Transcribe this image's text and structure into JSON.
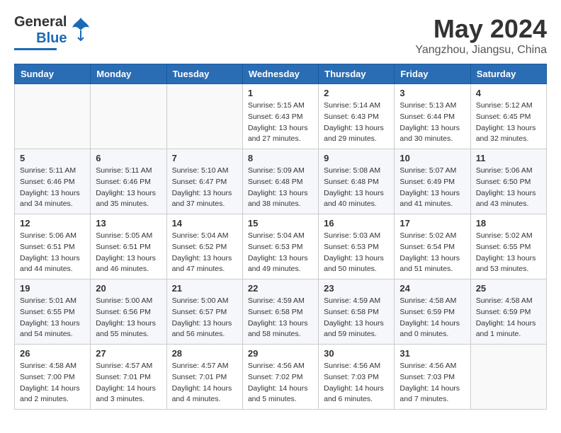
{
  "logo": {
    "line1": "General",
    "line2": "Blue"
  },
  "header": {
    "month_year": "May 2024",
    "location": "Yangzhou, Jiangsu, China"
  },
  "weekdays": [
    "Sunday",
    "Monday",
    "Tuesday",
    "Wednesday",
    "Thursday",
    "Friday",
    "Saturday"
  ],
  "weeks": [
    [
      {
        "day": "",
        "detail": ""
      },
      {
        "day": "",
        "detail": ""
      },
      {
        "day": "",
        "detail": ""
      },
      {
        "day": "1",
        "detail": "Sunrise: 5:15 AM\nSunset: 6:43 PM\nDaylight: 13 hours\nand 27 minutes."
      },
      {
        "day": "2",
        "detail": "Sunrise: 5:14 AM\nSunset: 6:43 PM\nDaylight: 13 hours\nand 29 minutes."
      },
      {
        "day": "3",
        "detail": "Sunrise: 5:13 AM\nSunset: 6:44 PM\nDaylight: 13 hours\nand 30 minutes."
      },
      {
        "day": "4",
        "detail": "Sunrise: 5:12 AM\nSunset: 6:45 PM\nDaylight: 13 hours\nand 32 minutes."
      }
    ],
    [
      {
        "day": "5",
        "detail": "Sunrise: 5:11 AM\nSunset: 6:46 PM\nDaylight: 13 hours\nand 34 minutes."
      },
      {
        "day": "6",
        "detail": "Sunrise: 5:11 AM\nSunset: 6:46 PM\nDaylight: 13 hours\nand 35 minutes."
      },
      {
        "day": "7",
        "detail": "Sunrise: 5:10 AM\nSunset: 6:47 PM\nDaylight: 13 hours\nand 37 minutes."
      },
      {
        "day": "8",
        "detail": "Sunrise: 5:09 AM\nSunset: 6:48 PM\nDaylight: 13 hours\nand 38 minutes."
      },
      {
        "day": "9",
        "detail": "Sunrise: 5:08 AM\nSunset: 6:48 PM\nDaylight: 13 hours\nand 40 minutes."
      },
      {
        "day": "10",
        "detail": "Sunrise: 5:07 AM\nSunset: 6:49 PM\nDaylight: 13 hours\nand 41 minutes."
      },
      {
        "day": "11",
        "detail": "Sunrise: 5:06 AM\nSunset: 6:50 PM\nDaylight: 13 hours\nand 43 minutes."
      }
    ],
    [
      {
        "day": "12",
        "detail": "Sunrise: 5:06 AM\nSunset: 6:51 PM\nDaylight: 13 hours\nand 44 minutes."
      },
      {
        "day": "13",
        "detail": "Sunrise: 5:05 AM\nSunset: 6:51 PM\nDaylight: 13 hours\nand 46 minutes."
      },
      {
        "day": "14",
        "detail": "Sunrise: 5:04 AM\nSunset: 6:52 PM\nDaylight: 13 hours\nand 47 minutes."
      },
      {
        "day": "15",
        "detail": "Sunrise: 5:04 AM\nSunset: 6:53 PM\nDaylight: 13 hours\nand 49 minutes."
      },
      {
        "day": "16",
        "detail": "Sunrise: 5:03 AM\nSunset: 6:53 PM\nDaylight: 13 hours\nand 50 minutes."
      },
      {
        "day": "17",
        "detail": "Sunrise: 5:02 AM\nSunset: 6:54 PM\nDaylight: 13 hours\nand 51 minutes."
      },
      {
        "day": "18",
        "detail": "Sunrise: 5:02 AM\nSunset: 6:55 PM\nDaylight: 13 hours\nand 53 minutes."
      }
    ],
    [
      {
        "day": "19",
        "detail": "Sunrise: 5:01 AM\nSunset: 6:55 PM\nDaylight: 13 hours\nand 54 minutes."
      },
      {
        "day": "20",
        "detail": "Sunrise: 5:00 AM\nSunset: 6:56 PM\nDaylight: 13 hours\nand 55 minutes."
      },
      {
        "day": "21",
        "detail": "Sunrise: 5:00 AM\nSunset: 6:57 PM\nDaylight: 13 hours\nand 56 minutes."
      },
      {
        "day": "22",
        "detail": "Sunrise: 4:59 AM\nSunset: 6:58 PM\nDaylight: 13 hours\nand 58 minutes."
      },
      {
        "day": "23",
        "detail": "Sunrise: 4:59 AM\nSunset: 6:58 PM\nDaylight: 13 hours\nand 59 minutes."
      },
      {
        "day": "24",
        "detail": "Sunrise: 4:58 AM\nSunset: 6:59 PM\nDaylight: 14 hours\nand 0 minutes."
      },
      {
        "day": "25",
        "detail": "Sunrise: 4:58 AM\nSunset: 6:59 PM\nDaylight: 14 hours\nand 1 minute."
      }
    ],
    [
      {
        "day": "26",
        "detail": "Sunrise: 4:58 AM\nSunset: 7:00 PM\nDaylight: 14 hours\nand 2 minutes."
      },
      {
        "day": "27",
        "detail": "Sunrise: 4:57 AM\nSunset: 7:01 PM\nDaylight: 14 hours\nand 3 minutes."
      },
      {
        "day": "28",
        "detail": "Sunrise: 4:57 AM\nSunset: 7:01 PM\nDaylight: 14 hours\nand 4 minutes."
      },
      {
        "day": "29",
        "detail": "Sunrise: 4:56 AM\nSunset: 7:02 PM\nDaylight: 14 hours\nand 5 minutes."
      },
      {
        "day": "30",
        "detail": "Sunrise: 4:56 AM\nSunset: 7:03 PM\nDaylight: 14 hours\nand 6 minutes."
      },
      {
        "day": "31",
        "detail": "Sunrise: 4:56 AM\nSunset: 7:03 PM\nDaylight: 14 hours\nand 7 minutes."
      },
      {
        "day": "",
        "detail": ""
      }
    ]
  ]
}
